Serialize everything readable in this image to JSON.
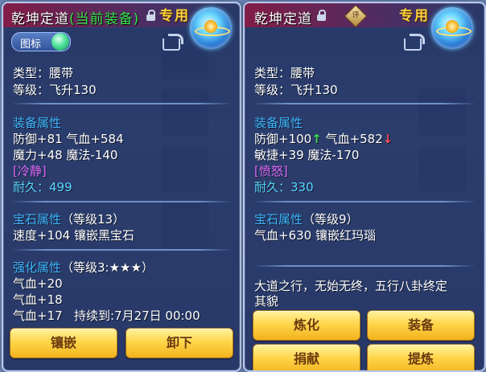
{
  "left": {
    "title": "乾坤定道",
    "current_tag": "(当前装备)",
    "exclusive": "专用",
    "marker_label": "图标",
    "type": "类型：腰带",
    "level": "等级：飞升130",
    "equip_section": "装备属性",
    "attr_row1": "防御+81 气血+584",
    "attr_row2": "魔力+48 魔法-140",
    "special": "[冷静]",
    "durability_label": "耐久：",
    "durability_value": "499",
    "gem_section": "宝石属性",
    "gem_level": "（等级13）",
    "gem_effect": "速度+104 镶嵌黑宝石",
    "enhance_section": "强化属性",
    "enhance_level": "（等级3:★★★）",
    "enhance_row1": "气血+20",
    "enhance_row2": "气血+18",
    "enhance_row3_value": "气血+17",
    "enhance_row3_duration": "持续到:7月27日 00:00",
    "buttons": [
      "镶嵌",
      "卸下"
    ]
  },
  "right": {
    "title": "乾坤定道",
    "exclusive": "专用",
    "type": "类型：腰带",
    "level": "等级：飞升130",
    "equip_section": "装备属性",
    "attr_def": "防御+100",
    "attr_hp": "气血+582",
    "attr_row2": "敏捷+39 魔法-170",
    "special": "[愤怒]",
    "durability_label": "耐久：",
    "durability_value": "330",
    "gem_section": "宝石属性",
    "gem_level": "（等级9）",
    "gem_effect": "气血+630 镶嵌红玛瑙",
    "description_line1": "大道之行，无始无终，五行八卦终定",
    "description_line2": "其貌",
    "buttons": [
      "炼化",
      "装备",
      "捐献",
      "提炼"
    ]
  },
  "colors": {
    "section": "#3fb7ff",
    "current_equipped": "#34e34b",
    "exclusive": "#ffd23a",
    "special": "#e06cff",
    "durability": "#5ad7ff",
    "stat_up": "#3ddc58",
    "stat_down": "#ff4b5c",
    "button": "#ffd64b"
  },
  "icons": [
    "lock-icon",
    "belt-item-icon",
    "share-icon",
    "jade-badge-icon",
    "up-arrow-icon",
    "down-arrow-icon"
  ]
}
